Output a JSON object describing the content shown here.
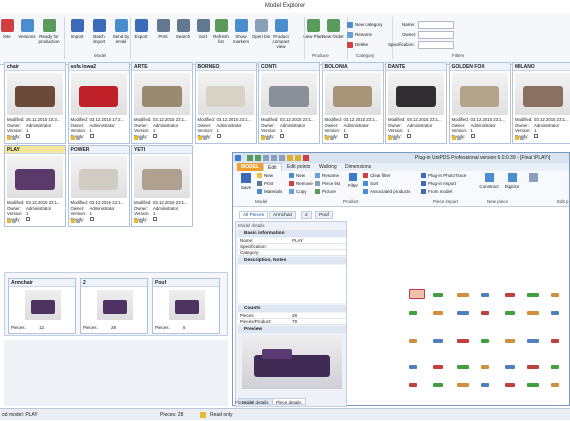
{
  "window": {
    "title": "Model Explorer"
  },
  "ribbon": {
    "buttons": [
      {
        "label": "lete",
        "icon": "delete-icon"
      },
      {
        "label": "Versions",
        "icon": "versions-icon"
      },
      {
        "label": "Ready for production",
        "icon": "ready-icon"
      },
      {
        "label": "Import",
        "icon": "import-icon"
      },
      {
        "label": "Batch import",
        "icon": "batch-import-icon"
      },
      {
        "label": "Send by email",
        "icon": "email-icon"
      },
      {
        "label": "Export",
        "icon": "export-icon"
      },
      {
        "label": "Print",
        "icon": "print-icon"
      },
      {
        "label": "Search",
        "icon": "search-icon"
      },
      {
        "label": "Sort",
        "icon": "sort-icon"
      },
      {
        "label": "Refresh list",
        "icon": "refresh-icon"
      },
      {
        "label": "Show markers",
        "icon": "markers-icon"
      },
      {
        "label": "Open bin",
        "icon": "bin-icon"
      },
      {
        "label": "Product compact view",
        "icon": "compact-view-icon"
      },
      {
        "label": "New Plan",
        "icon": "new-plan-icon"
      },
      {
        "label": "New Order",
        "icon": "new-order-icon"
      }
    ],
    "category": {
      "new": "New category",
      "rename": "Rename",
      "delete": "Delete"
    },
    "filters": {
      "name": "Name:",
      "owner": "Owner:",
      "spec": "Specification:"
    },
    "groups": {
      "model": "Model",
      "produce": "Produce",
      "category": "Category",
      "filters": "Filters"
    }
  },
  "cards": [
    {
      "name": "chair",
      "modified": "26.11.2015 10:3...",
      "owner": "Administrator",
      "version": "1",
      "photo": "#6b4a3a"
    },
    {
      "name": "sofa lowa2",
      "modified": "03.12.2015 17:2...",
      "owner": "Administrator",
      "version": "1",
      "photo": "#c02028"
    },
    {
      "name": "ARTE",
      "modified": "03.12.2015 23:1...",
      "owner": "Administrator",
      "version": "1",
      "photo": "#9a8a70"
    },
    {
      "name": "BORNEO",
      "modified": "03.12.2015 23:1...",
      "owner": "Administrator",
      "version": "1",
      "photo": "#d8d2c6"
    },
    {
      "name": "CONTI",
      "modified": "03.12.2015 23:1...",
      "owner": "Administrator",
      "version": "1",
      "photo": "#8a9098"
    },
    {
      "name": "BOLONIA",
      "modified": "03.12.2015 23:1...",
      "owner": "Administrator",
      "version": "1",
      "photo": "#a89478"
    },
    {
      "name": "DANTE",
      "modified": "03.12.2015 23:1...",
      "owner": "Administrator",
      "version": "1",
      "photo": "#302e30"
    },
    {
      "name": "GOLDEN FOX",
      "modified": "03.12.2015 23:1...",
      "owner": "Administrator",
      "version": "1",
      "photo": "#b4a48a"
    },
    {
      "name": "MILANO",
      "modified": "03.12.2015 23:1...",
      "owner": "Administrator",
      "version": "1",
      "photo": "#8a7060"
    },
    {
      "name": "PLAY",
      "modified": "03.12.2015 23:1...",
      "owner": "Administrator",
      "version": "1",
      "photo": "#5a3a6a"
    },
    {
      "name": "POWER",
      "modified": "03.12.2015 23:1...",
      "owner": "Administrator",
      "version": "1",
      "photo": "#d0ccc4"
    },
    {
      "name": "YETI",
      "modified": "03.12.2015 23:1...",
      "owner": "Administrator",
      "version": "1",
      "photo": "#b0a090"
    }
  ],
  "card_labels": {
    "modified": "Modified:",
    "owner": "Owner:",
    "version": "Version:",
    "ready": "Ready:"
  },
  "pieces_panels": [
    {
      "name": "Armchair",
      "count": "12"
    },
    {
      "name": "2",
      "count": "28"
    },
    {
      "name": "Pouf",
      "count": "5"
    }
  ],
  "pieces_label": "Pieces:",
  "plugin": {
    "title": "Plug-in UniPDS Professional version 6.0.0.39 - [Final \\PLAY\\]",
    "tabs": [
      "MODEL",
      "Edit",
      "Edit points",
      "Walking",
      "Dimensions"
    ],
    "model_group": {
      "save": "Save",
      "new": "New",
      "print": "Print",
      "materials": "Materials",
      "label": "Model"
    },
    "product_group": {
      "new": "New",
      "remove": "Remove",
      "copy": "Copy",
      "rename": "Rename",
      "piece_list": "Piece list",
      "picture": "Picture",
      "filter": "Filter",
      "clear_filter": "Clear filter",
      "sort": "Sort",
      "associated": "Associated products",
      "label": "Product"
    },
    "import_group": {
      "photo": "Plug-in PhotoTrace",
      "import": "Plug-in Import",
      "from_model": "From model",
      "label": "Piece import"
    },
    "piece_group": {
      "construct": "Construct",
      "digitize": "Digitize",
      "label": "New piece"
    },
    "edit_label": "Edit p",
    "view_tabs": [
      "All Pieces",
      "Armchair",
      "2",
      "Pouf"
    ],
    "details_title": "Model details",
    "basic": "Basic information",
    "name_key": "Name:",
    "name_val": "PLAY",
    "spec_key": "Specification:",
    "cat_key": "Category:",
    "desc": "Description, Notes",
    "counts": "Counts",
    "pieces_key": "Pieces:",
    "pieces_val": "28",
    "ppp_key": "Pieces/Product:",
    "ppp_val": "79",
    "preview": "Preview",
    "bottom_tabs": [
      "Model details",
      "Piece details"
    ],
    "piece_list_label": "Piece list"
  },
  "status": {
    "model": "od model: PLAY",
    "pieces": "Pieces: 28",
    "readonly": "Read only"
  }
}
